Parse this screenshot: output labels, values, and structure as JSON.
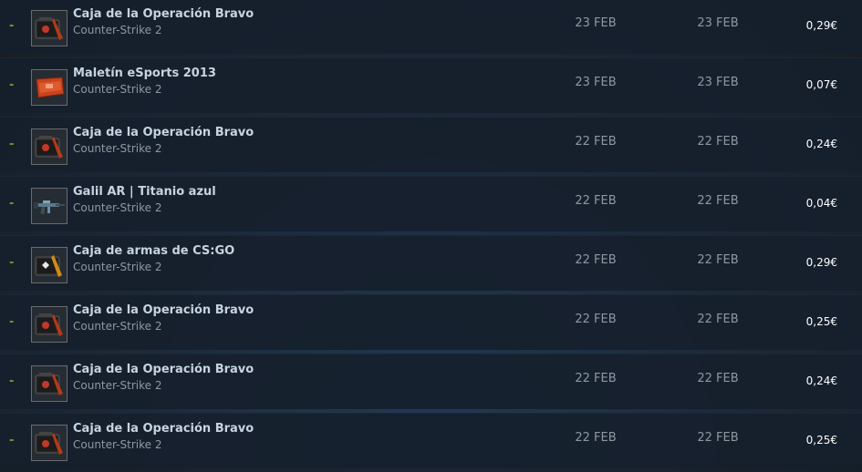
{
  "rows": [
    {
      "dash": "-",
      "name": "Caja de la Operación Bravo",
      "game": "Counter-Strike 2",
      "listed": "23 FEB",
      "acted": "23 FEB",
      "price": "0,29€",
      "icon": "operation-bravo-case-icon"
    },
    {
      "dash": "-",
      "name": "Maletín eSports 2013",
      "game": "Counter-Strike 2",
      "listed": "23 FEB",
      "acted": "23 FEB",
      "price": "0,07€",
      "icon": "esports-2013-case-icon"
    },
    {
      "dash": "-",
      "name": "Caja de la Operación Bravo",
      "game": "Counter-Strike 2",
      "listed": "22 FEB",
      "acted": "22 FEB",
      "price": "0,24€",
      "icon": "operation-bravo-case-icon"
    },
    {
      "dash": "-",
      "name": "Galil AR | Titanio azul",
      "game": "Counter-Strike 2",
      "listed": "22 FEB",
      "acted": "22 FEB",
      "price": "0,04€",
      "icon": "galil-ar-rifle-icon"
    },
    {
      "dash": "-",
      "name": "Caja de armas de CS:GO",
      "game": "Counter-Strike 2",
      "listed": "22 FEB",
      "acted": "22 FEB",
      "price": "0,29€",
      "icon": "csgo-weapon-case-icon"
    },
    {
      "dash": "-",
      "name": "Caja de la Operación Bravo",
      "game": "Counter-Strike 2",
      "listed": "22 FEB",
      "acted": "22 FEB",
      "price": "0,25€",
      "icon": "operation-bravo-case-icon"
    },
    {
      "dash": "-",
      "name": "Caja de la Operación Bravo",
      "game": "Counter-Strike 2",
      "listed": "22 FEB",
      "acted": "22 FEB",
      "price": "0,24€",
      "icon": "operation-bravo-case-icon"
    },
    {
      "dash": "-",
      "name": "Caja de la Operación Bravo",
      "game": "Counter-Strike 2",
      "listed": "22 FEB",
      "acted": "22 FEB",
      "price": "0,25€",
      "icon": "operation-bravo-case-icon"
    }
  ],
  "colors": {
    "dash": "#6f9a2a",
    "name": "#c6d4df",
    "muted": "#8f98a0",
    "price": "#ffffff",
    "row_bg": "#16202d"
  }
}
